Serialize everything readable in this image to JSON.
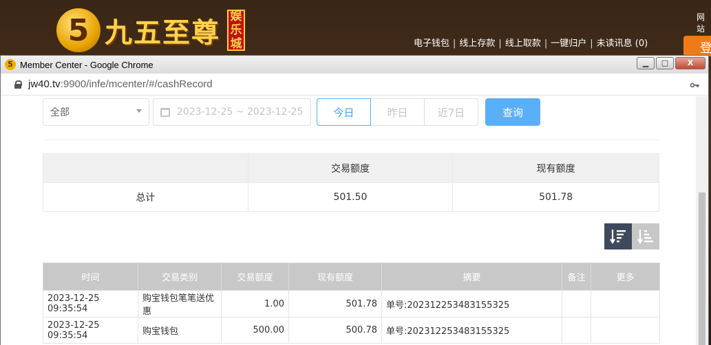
{
  "background_site": {
    "logo_number": "5",
    "logo_title": "九五至尊",
    "logo_badge": [
      "娱",
      "乐",
      "城"
    ],
    "nav": [
      "电子钱包",
      "线上存款",
      "线上取款",
      "一键归户",
      "未读讯息 (0)"
    ],
    "top_right": "网站",
    "login_label": "登"
  },
  "window": {
    "title": "Member Center - Google Chrome",
    "url_host": "jw40.tv",
    "url_path": ":9900/infe/mcenter/#/cashRecord",
    "controls": {
      "minimize": "▁",
      "maximize": "□",
      "close": "X"
    }
  },
  "filters": {
    "type_select": "全部",
    "date_range": "2023-12-25 ~ 2023-12-25",
    "quick": [
      "今日",
      "昨日",
      "近7日"
    ],
    "quick_active": "今日",
    "query_label": "查询"
  },
  "summary": {
    "headers": [
      "",
      "交易额度",
      "现有额度"
    ],
    "row": {
      "label": "总计",
      "amount": "501.50",
      "balance": "501.78"
    }
  },
  "records": {
    "headers": {
      "time": "时间",
      "type": "交易类别",
      "amount": "交易额度",
      "balance": "现有额度",
      "summary": "摘要",
      "note": "备注",
      "more": "更多"
    },
    "rows": [
      {
        "time": "2023-12-25 09:35:54",
        "type": "购宝钱包笔笔送优惠",
        "amount": "1.00",
        "balance": "501.78",
        "summary": "单号:202312253483155325",
        "note": "",
        "more": ""
      },
      {
        "time": "2023-12-25 09:35:54",
        "type": "购宝钱包",
        "amount": "500.00",
        "balance": "500.78",
        "summary": "单号:202312253483155325",
        "note": "",
        "more": ""
      }
    ]
  },
  "colors": {
    "primary": "#409eff",
    "query_button": "#5aaff9",
    "sort_active": "#3e4a5c",
    "table_header": "#c8c8c8"
  }
}
